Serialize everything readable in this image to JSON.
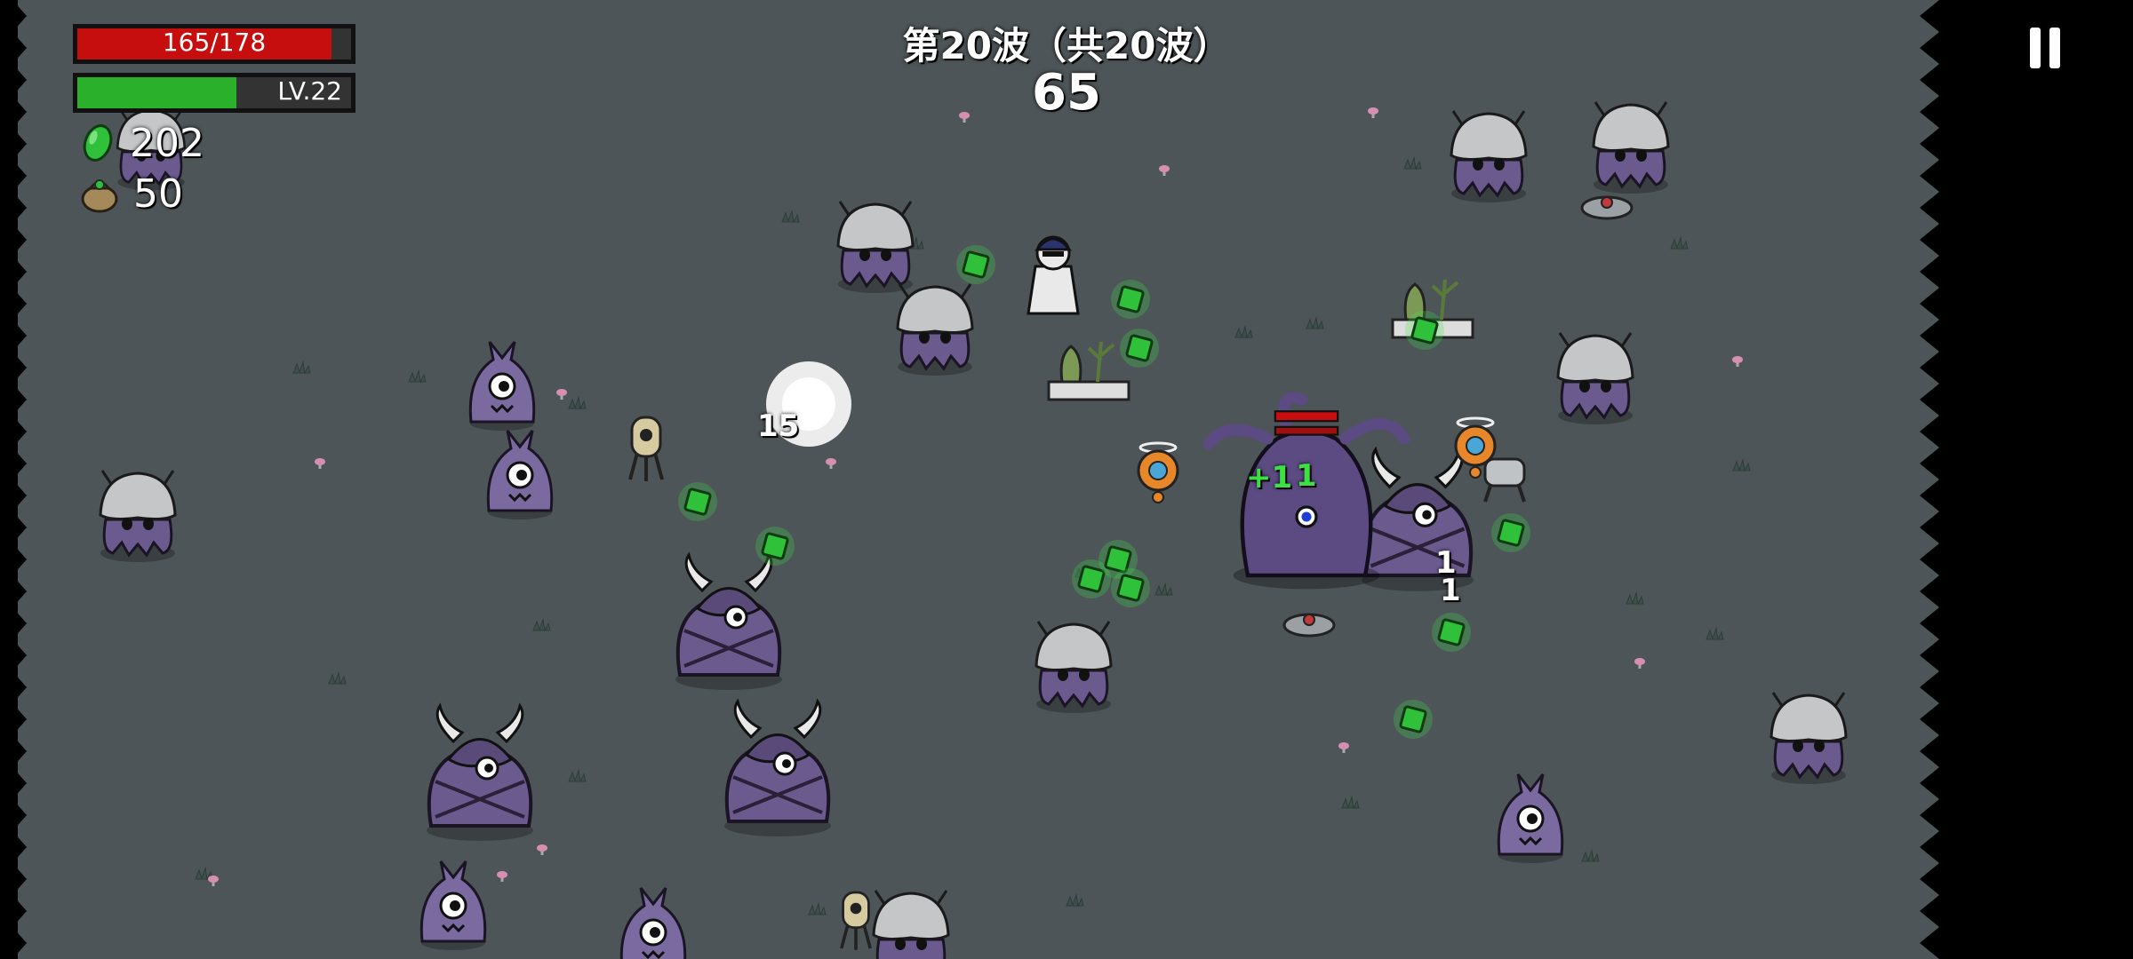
{
  "hud": {
    "hp_text": "165/178",
    "hp_fraction": 0.927,
    "level_text": "LV.22",
    "xp_fraction": 0.58,
    "materials": "202",
    "bag": "50",
    "wave_title": "第20波（共20波）",
    "timer": "65"
  },
  "floaters": {
    "damage_main": "15",
    "heal": "+1",
    "heal_second": "1",
    "hit_a": "1",
    "hit_b": "1"
  },
  "colors": {
    "ground": "#4e5558",
    "hp": "#c70e0e",
    "xp": "#2bb02b",
    "material": "#2fc13a",
    "enemy": "#6b5a8e",
    "enemy_dark": "#3e3258",
    "helmet": "#c4c6c7"
  },
  "icons": {
    "material": "green-material-icon",
    "bag": "money-bag-icon",
    "pause": "pause-icon"
  }
}
